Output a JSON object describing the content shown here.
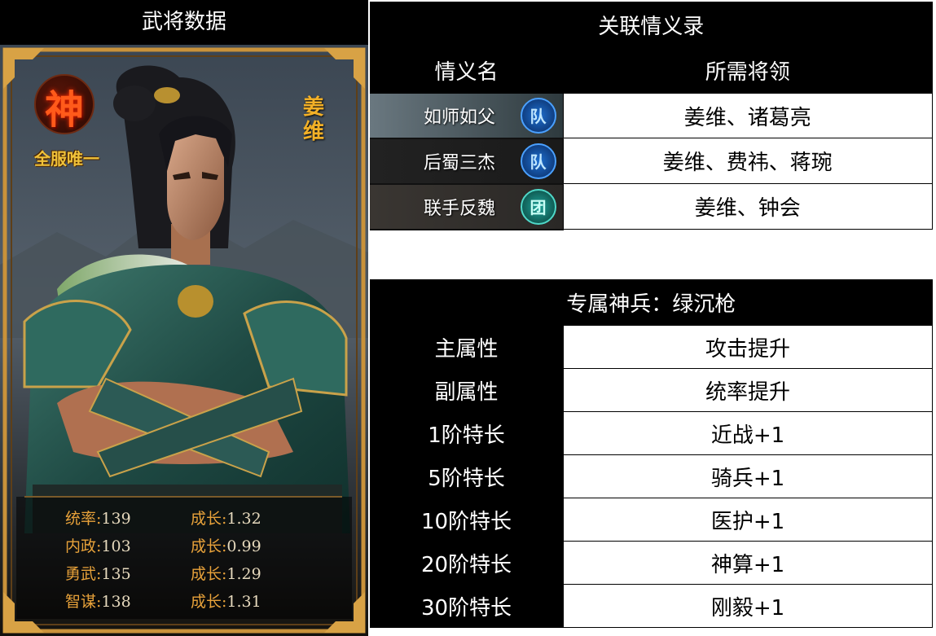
{
  "left_panel": {
    "title": "武将数据",
    "hero_name": "姜维",
    "badge_char": "神",
    "badge_text": "全服唯一",
    "stats": [
      {
        "label": "统率:",
        "value": "139",
        "growth_label": "成长:",
        "growth": "1.32"
      },
      {
        "label": "内政:",
        "value": "103",
        "growth_label": "成长:",
        "growth": "0.99"
      },
      {
        "label": "勇武:",
        "value": "135",
        "growth_label": "成长:",
        "growth": "1.29"
      },
      {
        "label": "智谋:",
        "value": "138",
        "growth_label": "成长:",
        "growth": "1.31"
      }
    ]
  },
  "bonds": {
    "title": "关联情义录",
    "col_name": "情义名",
    "col_generals": "所需将领",
    "rows": [
      {
        "name": "如师如父",
        "icon": "队",
        "icon_type": "team-icon",
        "generals": "姜维、诸葛亮"
      },
      {
        "name": "后蜀三杰",
        "icon": "队",
        "icon_type": "team-icon",
        "generals": "姜维、费祎、蒋琬"
      },
      {
        "name": "联手反魏",
        "icon": "团",
        "icon_type": "group-icon",
        "generals": "姜维、钟会"
      }
    ]
  },
  "weapon": {
    "title": "专属神兵：绿沉枪",
    "rows": [
      {
        "label": "主属性",
        "value": "攻击提升"
      },
      {
        "label": "副属性",
        "value": "统率提升"
      },
      {
        "label": "1阶特长",
        "value": "近战+1"
      },
      {
        "label": "5阶特长",
        "value": "骑兵+1"
      },
      {
        "label": "10阶特长",
        "value": "医护+1"
      },
      {
        "label": "20阶特长",
        "value": "神算+1"
      },
      {
        "label": "30阶特长",
        "value": "刚毅+1"
      }
    ]
  },
  "colors": {
    "gold": "#f2b027",
    "stat_label": "#e8a23a",
    "frame": "#c9923a",
    "team_icon": "#1e6fd0",
    "group_icon": "#1fa39a"
  }
}
